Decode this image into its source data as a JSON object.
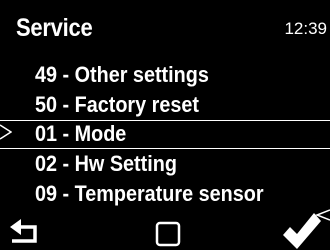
{
  "header": {
    "title": "Service",
    "time": "12:39"
  },
  "menu": {
    "items": [
      {
        "label": "49 - Other settings",
        "selected": false
      },
      {
        "label": "50 - Factory reset",
        "selected": false
      },
      {
        "label": "01 - Mode",
        "selected": true
      },
      {
        "label": "02 - Hw Setting",
        "selected": false
      },
      {
        "label": "09 - Temperature sensor",
        "selected": false
      }
    ]
  },
  "softkeys": {
    "back": "back-arrow-icon",
    "home": "square-icon",
    "ok": "checkmark-icon"
  },
  "colors": {
    "background": "#000000",
    "foreground": "#ffffff"
  }
}
